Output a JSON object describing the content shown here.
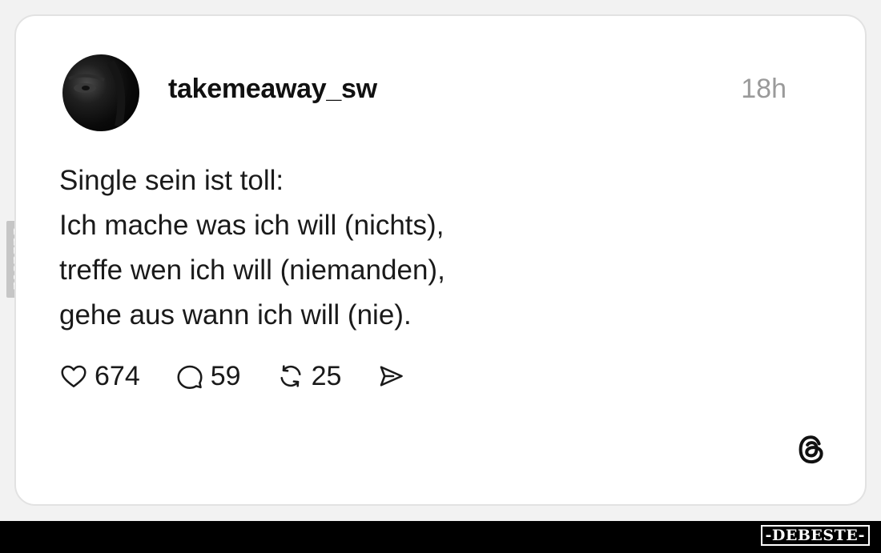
{
  "post": {
    "username": "takemeaway_sw",
    "time": "18h",
    "text_lines": [
      "Single sein ist toll:",
      "Ich mache was ich will (nichts),",
      "treffe wen ich will (niemanden),",
      "gehe aus wann ich will (nie)."
    ],
    "actions": {
      "likes": "674",
      "comments": "59",
      "reposts": "25"
    },
    "icons": {
      "like": "heart-icon",
      "comment": "comment-bubble-icon",
      "repost": "repost-icon",
      "share": "send-icon",
      "brand": "threads-logo-icon"
    }
  },
  "watermark": {
    "side_label": "DEBESTE",
    "footer_label": "-DEBESTE-"
  },
  "colors": {
    "background": "#f2f2f2",
    "card": "#ffffff",
    "card_border": "#e2e2e2",
    "text": "#1a1a1a",
    "muted": "#9a9a9a",
    "footer": "#000000"
  }
}
